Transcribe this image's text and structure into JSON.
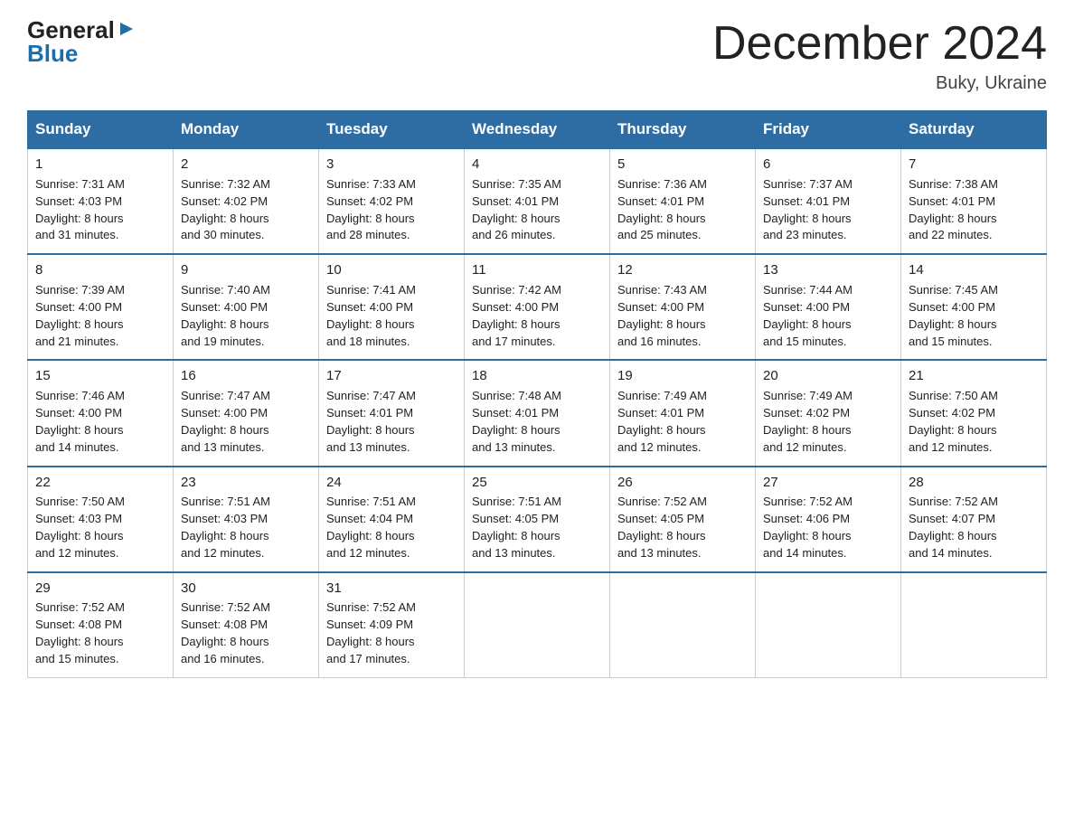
{
  "logo": {
    "general": "General",
    "blue": "Blue",
    "arrow": "▶"
  },
  "title": "December 2024",
  "location": "Buky, Ukraine",
  "days_of_week": [
    "Sunday",
    "Monday",
    "Tuesday",
    "Wednesday",
    "Thursday",
    "Friday",
    "Saturday"
  ],
  "weeks": [
    [
      {
        "day": "1",
        "sunrise": "7:31 AM",
        "sunset": "4:03 PM",
        "daylight": "8 hours and 31 minutes."
      },
      {
        "day": "2",
        "sunrise": "7:32 AM",
        "sunset": "4:02 PM",
        "daylight": "8 hours and 30 minutes."
      },
      {
        "day": "3",
        "sunrise": "7:33 AM",
        "sunset": "4:02 PM",
        "daylight": "8 hours and 28 minutes."
      },
      {
        "day": "4",
        "sunrise": "7:35 AM",
        "sunset": "4:01 PM",
        "daylight": "8 hours and 26 minutes."
      },
      {
        "day": "5",
        "sunrise": "7:36 AM",
        "sunset": "4:01 PM",
        "daylight": "8 hours and 25 minutes."
      },
      {
        "day": "6",
        "sunrise": "7:37 AM",
        "sunset": "4:01 PM",
        "daylight": "8 hours and 23 minutes."
      },
      {
        "day": "7",
        "sunrise": "7:38 AM",
        "sunset": "4:01 PM",
        "daylight": "8 hours and 22 minutes."
      }
    ],
    [
      {
        "day": "8",
        "sunrise": "7:39 AM",
        "sunset": "4:00 PM",
        "daylight": "8 hours and 21 minutes."
      },
      {
        "day": "9",
        "sunrise": "7:40 AM",
        "sunset": "4:00 PM",
        "daylight": "8 hours and 19 minutes."
      },
      {
        "day": "10",
        "sunrise": "7:41 AM",
        "sunset": "4:00 PM",
        "daylight": "8 hours and 18 minutes."
      },
      {
        "day": "11",
        "sunrise": "7:42 AM",
        "sunset": "4:00 PM",
        "daylight": "8 hours and 17 minutes."
      },
      {
        "day": "12",
        "sunrise": "7:43 AM",
        "sunset": "4:00 PM",
        "daylight": "8 hours and 16 minutes."
      },
      {
        "day": "13",
        "sunrise": "7:44 AM",
        "sunset": "4:00 PM",
        "daylight": "8 hours and 15 minutes."
      },
      {
        "day": "14",
        "sunrise": "7:45 AM",
        "sunset": "4:00 PM",
        "daylight": "8 hours and 15 minutes."
      }
    ],
    [
      {
        "day": "15",
        "sunrise": "7:46 AM",
        "sunset": "4:00 PM",
        "daylight": "8 hours and 14 minutes."
      },
      {
        "day": "16",
        "sunrise": "7:47 AM",
        "sunset": "4:00 PM",
        "daylight": "8 hours and 13 minutes."
      },
      {
        "day": "17",
        "sunrise": "7:47 AM",
        "sunset": "4:01 PM",
        "daylight": "8 hours and 13 minutes."
      },
      {
        "day": "18",
        "sunrise": "7:48 AM",
        "sunset": "4:01 PM",
        "daylight": "8 hours and 13 minutes."
      },
      {
        "day": "19",
        "sunrise": "7:49 AM",
        "sunset": "4:01 PM",
        "daylight": "8 hours and 12 minutes."
      },
      {
        "day": "20",
        "sunrise": "7:49 AM",
        "sunset": "4:02 PM",
        "daylight": "8 hours and 12 minutes."
      },
      {
        "day": "21",
        "sunrise": "7:50 AM",
        "sunset": "4:02 PM",
        "daylight": "8 hours and 12 minutes."
      }
    ],
    [
      {
        "day": "22",
        "sunrise": "7:50 AM",
        "sunset": "4:03 PM",
        "daylight": "8 hours and 12 minutes."
      },
      {
        "day": "23",
        "sunrise": "7:51 AM",
        "sunset": "4:03 PM",
        "daylight": "8 hours and 12 minutes."
      },
      {
        "day": "24",
        "sunrise": "7:51 AM",
        "sunset": "4:04 PM",
        "daylight": "8 hours and 12 minutes."
      },
      {
        "day": "25",
        "sunrise": "7:51 AM",
        "sunset": "4:05 PM",
        "daylight": "8 hours and 13 minutes."
      },
      {
        "day": "26",
        "sunrise": "7:52 AM",
        "sunset": "4:05 PM",
        "daylight": "8 hours and 13 minutes."
      },
      {
        "day": "27",
        "sunrise": "7:52 AM",
        "sunset": "4:06 PM",
        "daylight": "8 hours and 14 minutes."
      },
      {
        "day": "28",
        "sunrise": "7:52 AM",
        "sunset": "4:07 PM",
        "daylight": "8 hours and 14 minutes."
      }
    ],
    [
      {
        "day": "29",
        "sunrise": "7:52 AM",
        "sunset": "4:08 PM",
        "daylight": "8 hours and 15 minutes."
      },
      {
        "day": "30",
        "sunrise": "7:52 AM",
        "sunset": "4:08 PM",
        "daylight": "8 hours and 16 minutes."
      },
      {
        "day": "31",
        "sunrise": "7:52 AM",
        "sunset": "4:09 PM",
        "daylight": "8 hours and 17 minutes."
      },
      null,
      null,
      null,
      null
    ]
  ],
  "cell_labels": {
    "sunrise": "Sunrise:",
    "sunset": "Sunset:",
    "daylight": "Daylight:"
  }
}
